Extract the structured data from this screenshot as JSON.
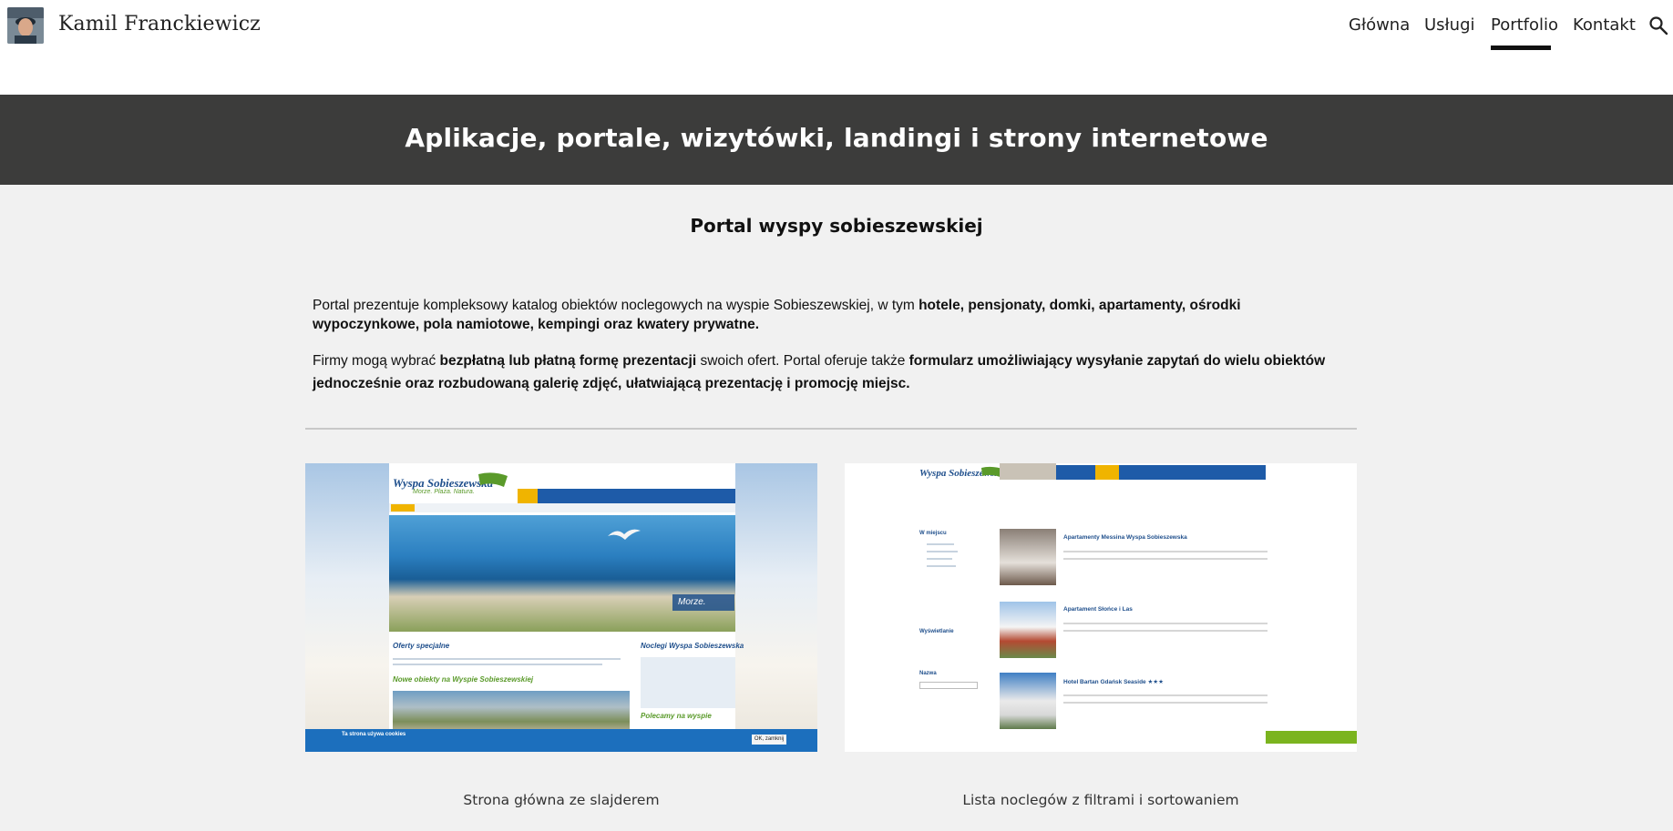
{
  "header": {
    "site_name": "Kamil Franckiewicz",
    "nav": [
      {
        "label": "Główna",
        "active": false
      },
      {
        "label": "Usługi",
        "active": false
      },
      {
        "label": "Portfolio",
        "active": true
      },
      {
        "label": "Kontakt",
        "active": false
      }
    ],
    "search_icon": "search-icon"
  },
  "hero": {
    "title": "Aplikacje, portale, wizytówki, landingi i strony internetowe"
  },
  "section": {
    "title": "Portal wyspy sobieszewskiej",
    "p1_plain": "Portal prezentuje kompleksowy katalog obiektów noclegowych na wyspie Sobieszewskiej, w tym ",
    "p1_bold": "hotele, pensjonaty, domki, apartamenty, ośrodki wypoczynkowe, pola namiotowe, kempingi oraz kwatery prywatne.",
    "p2_plain1": "Firmy mogą wybrać ",
    "p2_bold1": "bezpłatną lub płatną formę prezentacji",
    "p2_plain2": " swoich ofert. Portal oferuje także ",
    "p2_bold2": "formularz umożliwiający wysyłanie zapytań do wielu obiektów jednocześnie oraz rozbudowaną galerię zdjęć, ułatwiającą prezentację i promocję miejsc."
  },
  "gallery": [
    {
      "caption": "Strona główna ze slajderem"
    },
    {
      "caption": "Lista noclegów z filtrami i sortowaniem"
    }
  ],
  "mock_home": {
    "logo": "Wyspa Sobieszewska",
    "tagline": "Morze. Plaża. Natura.",
    "banner_caption": "Morze.",
    "heading_offers": "Oferty specjalne",
    "heading_new": "Nowe obiekty na Wyspie Sobieszewskiej",
    "heading_stays": "Noclegi Wyspa Sobieszewska",
    "heading_recommended": "Polecamy na wyspie",
    "cookie_title": "Ta strona używa cookies",
    "ok_button": "OK, zamknij"
  },
  "mock_list": {
    "logo": "Wyspa Sobieszewska",
    "side_location": "W miejscu",
    "side_show": "Wyświetlanie",
    "side_name": "Nazwa",
    "items": [
      {
        "title": "Apartamenty Messina Wyspa Sobieszewska"
      },
      {
        "title": "Apartament Słońce i Las"
      },
      {
        "title": "Hotel Bartan Gdańsk Seaside ★★★"
      }
    ]
  },
  "colors": {
    "hero_bg": "#3c3c3b",
    "page_bg": "#f1f1f1",
    "accent_underline": "#111111"
  }
}
